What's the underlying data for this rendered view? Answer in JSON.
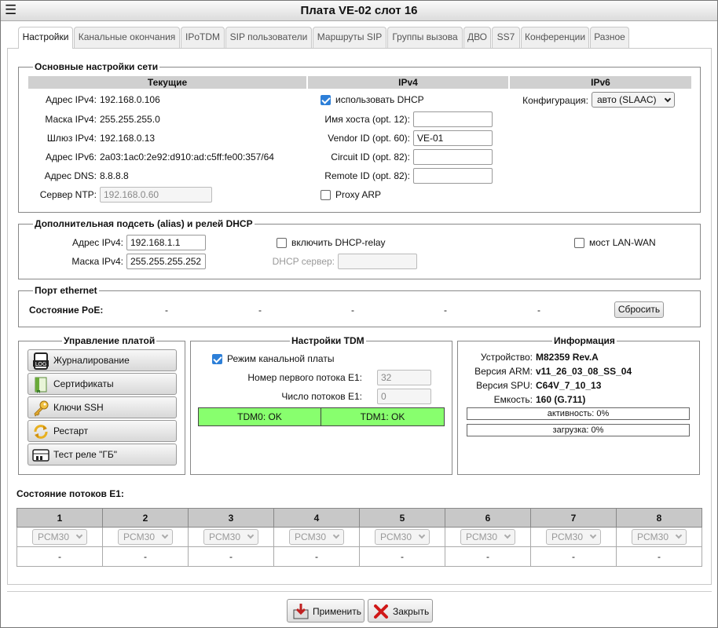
{
  "window": {
    "title": "Плата VE-02 слот 16",
    "menu_icon": "hamburger-icon"
  },
  "tabs": [
    {
      "label": "Настройки",
      "active": true
    },
    {
      "label": "Канальные окончания"
    },
    {
      "label": "IPoTDM"
    },
    {
      "label": "SIP пользователи"
    },
    {
      "label": "Маршруты SIP"
    },
    {
      "label": "Группы вызова"
    },
    {
      "label": "ДВО"
    },
    {
      "label": "SS7"
    },
    {
      "label": "Конференции"
    },
    {
      "label": "Разное"
    }
  ],
  "network": {
    "legend": "Основные настройки сети",
    "col_current": "Текущие",
    "col_ipv4": "IPv4",
    "col_ipv6": "IPv6",
    "current": {
      "ipv4_label": "Адрес IPv4:",
      "ipv4_value": "192.168.0.106",
      "mask_label": "Маска IPv4:",
      "mask_value": "255.255.255.0",
      "gw_label": "Шлюз IPv4:",
      "gw_value": "192.168.0.13",
      "ipv6_label": "Адрес IPv6:",
      "ipv6_value": "2a03:1ac0:2e92:d910:ad:c5ff:fe00:357/64",
      "dns_label": "Адрес DNS:",
      "dns_value": "8.8.8.8",
      "ntp_label": "Сервер NTP:",
      "ntp_placeholder": "192.168.0.60"
    },
    "ipv4": {
      "dhcp_label": "использовать DHCP",
      "dhcp_checked": true,
      "host_label": "Имя хоста (opt. 12):",
      "host_value": "",
      "vendor_label": "Vendor ID (opt. 60):",
      "vendor_value": "VE-01",
      "circuit_label": "Circuit ID (opt. 82):",
      "circuit_value": "",
      "remote_label": "Remote ID (opt. 82):",
      "remote_value": "",
      "proxy_label": "Proxy ARP",
      "proxy_checked": false
    },
    "ipv6": {
      "config_label": "Конфигурация:",
      "config_value": "авто (SLAAC)"
    }
  },
  "alias": {
    "legend": "Дополнительная подсеть (alias) и релей DHCP",
    "ipv4_label": "Адрес IPv4:",
    "ipv4_value": "192.168.1.1",
    "mask_label": "Маска IPv4:",
    "mask_value": "255.255.255.252",
    "relay_label": "включить DHCP-relay",
    "relay_checked": false,
    "server_label": "DHCP сервер:",
    "server_value": "",
    "bridge_label": "мост LAN-WAN",
    "bridge_checked": false
  },
  "ethernet": {
    "legend": "Порт ethernet",
    "poe_label": "Состояние PoE:",
    "poe_values": [
      "-",
      "-",
      "-",
      "-",
      "-"
    ],
    "reset_label": "Сбросить"
  },
  "board": {
    "legend": "Управление платой",
    "buttons": [
      {
        "label": "Журналирование",
        "icon": "log-icon"
      },
      {
        "label": "Сертификаты",
        "icon": "certificate-icon"
      },
      {
        "label": "Ключи SSH",
        "icon": "key-icon"
      },
      {
        "label": "Рестарт",
        "icon": "restart-icon"
      },
      {
        "label": "Тест реле \"ГБ\"",
        "icon": "relay-icon"
      }
    ]
  },
  "tdm": {
    "legend": "Настройки TDM",
    "mode_label": "Режим канальной платы",
    "mode_checked": true,
    "first_label": "Номер первого потока E1:",
    "first_value": "32",
    "count_label": "Число потоков E1:",
    "count_value": "0",
    "status": [
      "TDM0: OK",
      "TDM1: OK"
    ],
    "status_color": "#88ff6e"
  },
  "info": {
    "legend": "Информация",
    "device_label": "Устройство:",
    "device_value": "M82359 Rev.A",
    "arm_label": "Версия ARM:",
    "arm_value": "v11_26_03_08_SS_04",
    "spu_label": "Версия SPU:",
    "spu_value": "C64V_7_10_13",
    "cap_label": "Емкость:",
    "cap_value": "160 (G.711)",
    "activity": "активность: 0%",
    "load": "загрузка: 0%"
  },
  "e1": {
    "title": "Состояние потоков E1:",
    "columns": [
      "1",
      "2",
      "3",
      "4",
      "5",
      "6",
      "7",
      "8"
    ],
    "modes": [
      "PCM30",
      "PCM30",
      "PCM30",
      "PCM30",
      "PCM30",
      "PCM30",
      "PCM30",
      "PCM30"
    ],
    "states": [
      "-",
      "-",
      "-",
      "-",
      "-",
      "-",
      "-",
      "-"
    ]
  },
  "footer": {
    "apply_label": "Применить",
    "close_label": "Закрыть"
  }
}
